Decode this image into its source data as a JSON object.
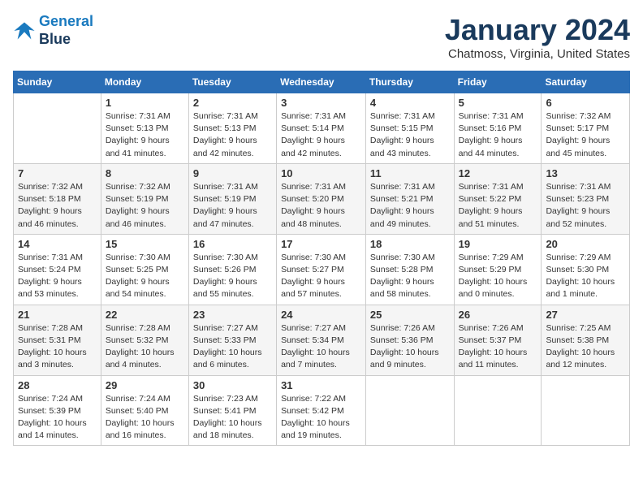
{
  "header": {
    "logo_line1": "General",
    "logo_line2": "Blue",
    "title": "January 2024",
    "subtitle": "Chatmoss, Virginia, United States"
  },
  "days_of_week": [
    "Sunday",
    "Monday",
    "Tuesday",
    "Wednesday",
    "Thursday",
    "Friday",
    "Saturday"
  ],
  "weeks": [
    [
      {
        "day": "",
        "info": ""
      },
      {
        "day": "1",
        "info": "Sunrise: 7:31 AM\nSunset: 5:13 PM\nDaylight: 9 hours\nand 41 minutes."
      },
      {
        "day": "2",
        "info": "Sunrise: 7:31 AM\nSunset: 5:13 PM\nDaylight: 9 hours\nand 42 minutes."
      },
      {
        "day": "3",
        "info": "Sunrise: 7:31 AM\nSunset: 5:14 PM\nDaylight: 9 hours\nand 42 minutes."
      },
      {
        "day": "4",
        "info": "Sunrise: 7:31 AM\nSunset: 5:15 PM\nDaylight: 9 hours\nand 43 minutes."
      },
      {
        "day": "5",
        "info": "Sunrise: 7:31 AM\nSunset: 5:16 PM\nDaylight: 9 hours\nand 44 minutes."
      },
      {
        "day": "6",
        "info": "Sunrise: 7:32 AM\nSunset: 5:17 PM\nDaylight: 9 hours\nand 45 minutes."
      }
    ],
    [
      {
        "day": "7",
        "info": "Sunrise: 7:32 AM\nSunset: 5:18 PM\nDaylight: 9 hours\nand 46 minutes."
      },
      {
        "day": "8",
        "info": "Sunrise: 7:32 AM\nSunset: 5:19 PM\nDaylight: 9 hours\nand 46 minutes."
      },
      {
        "day": "9",
        "info": "Sunrise: 7:31 AM\nSunset: 5:19 PM\nDaylight: 9 hours\nand 47 minutes."
      },
      {
        "day": "10",
        "info": "Sunrise: 7:31 AM\nSunset: 5:20 PM\nDaylight: 9 hours\nand 48 minutes."
      },
      {
        "day": "11",
        "info": "Sunrise: 7:31 AM\nSunset: 5:21 PM\nDaylight: 9 hours\nand 49 minutes."
      },
      {
        "day": "12",
        "info": "Sunrise: 7:31 AM\nSunset: 5:22 PM\nDaylight: 9 hours\nand 51 minutes."
      },
      {
        "day": "13",
        "info": "Sunrise: 7:31 AM\nSunset: 5:23 PM\nDaylight: 9 hours\nand 52 minutes."
      }
    ],
    [
      {
        "day": "14",
        "info": "Sunrise: 7:31 AM\nSunset: 5:24 PM\nDaylight: 9 hours\nand 53 minutes."
      },
      {
        "day": "15",
        "info": "Sunrise: 7:30 AM\nSunset: 5:25 PM\nDaylight: 9 hours\nand 54 minutes."
      },
      {
        "day": "16",
        "info": "Sunrise: 7:30 AM\nSunset: 5:26 PM\nDaylight: 9 hours\nand 55 minutes."
      },
      {
        "day": "17",
        "info": "Sunrise: 7:30 AM\nSunset: 5:27 PM\nDaylight: 9 hours\nand 57 minutes."
      },
      {
        "day": "18",
        "info": "Sunrise: 7:30 AM\nSunset: 5:28 PM\nDaylight: 9 hours\nand 58 minutes."
      },
      {
        "day": "19",
        "info": "Sunrise: 7:29 AM\nSunset: 5:29 PM\nDaylight: 10 hours\nand 0 minutes."
      },
      {
        "day": "20",
        "info": "Sunrise: 7:29 AM\nSunset: 5:30 PM\nDaylight: 10 hours\nand 1 minute."
      }
    ],
    [
      {
        "day": "21",
        "info": "Sunrise: 7:28 AM\nSunset: 5:31 PM\nDaylight: 10 hours\nand 3 minutes."
      },
      {
        "day": "22",
        "info": "Sunrise: 7:28 AM\nSunset: 5:32 PM\nDaylight: 10 hours\nand 4 minutes."
      },
      {
        "day": "23",
        "info": "Sunrise: 7:27 AM\nSunset: 5:33 PM\nDaylight: 10 hours\nand 6 minutes."
      },
      {
        "day": "24",
        "info": "Sunrise: 7:27 AM\nSunset: 5:34 PM\nDaylight: 10 hours\nand 7 minutes."
      },
      {
        "day": "25",
        "info": "Sunrise: 7:26 AM\nSunset: 5:36 PM\nDaylight: 10 hours\nand 9 minutes."
      },
      {
        "day": "26",
        "info": "Sunrise: 7:26 AM\nSunset: 5:37 PM\nDaylight: 10 hours\nand 11 minutes."
      },
      {
        "day": "27",
        "info": "Sunrise: 7:25 AM\nSunset: 5:38 PM\nDaylight: 10 hours\nand 12 minutes."
      }
    ],
    [
      {
        "day": "28",
        "info": "Sunrise: 7:24 AM\nSunset: 5:39 PM\nDaylight: 10 hours\nand 14 minutes."
      },
      {
        "day": "29",
        "info": "Sunrise: 7:24 AM\nSunset: 5:40 PM\nDaylight: 10 hours\nand 16 minutes."
      },
      {
        "day": "30",
        "info": "Sunrise: 7:23 AM\nSunset: 5:41 PM\nDaylight: 10 hours\nand 18 minutes."
      },
      {
        "day": "31",
        "info": "Sunrise: 7:22 AM\nSunset: 5:42 PM\nDaylight: 10 hours\nand 19 minutes."
      },
      {
        "day": "",
        "info": ""
      },
      {
        "day": "",
        "info": ""
      },
      {
        "day": "",
        "info": ""
      }
    ]
  ]
}
